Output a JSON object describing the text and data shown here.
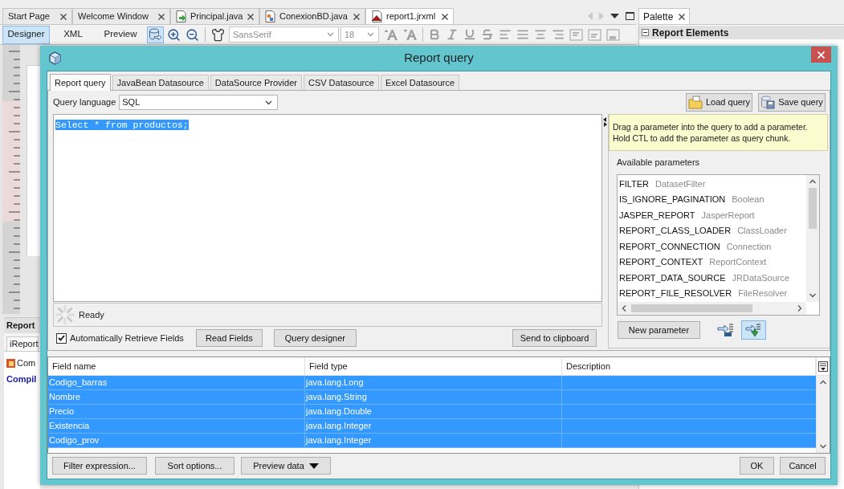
{
  "ide": {
    "editor_tabs": [
      {
        "label": "Start Page",
        "kind": "page",
        "selected": false
      },
      {
        "label": "Welcome Window",
        "kind": "page",
        "selected": false
      },
      {
        "label": "Principal.java",
        "kind": "main-class",
        "selected": false
      },
      {
        "label": "ConexionBD.java",
        "kind": "class",
        "selected": false
      },
      {
        "label": "report1.jrxml",
        "kind": "report",
        "selected": true
      }
    ],
    "view_tabs": [
      {
        "label": "Designer",
        "selected": true
      },
      {
        "label": "XML",
        "selected": false
      },
      {
        "label": "Preview",
        "selected": false
      }
    ],
    "tools": [
      {
        "kind": "query",
        "selected": true
      },
      {
        "kind": "zoom-in",
        "selected": false
      },
      {
        "kind": "zoom-out",
        "selected": false
      },
      {
        "kind": "format",
        "selected": false
      }
    ],
    "formatting": {
      "font": "SansSerif",
      "size": "18",
      "disabled": true
    },
    "palette": {
      "title": "Palette",
      "section": {
        "title": "Report Elements",
        "expanded": true
      }
    },
    "output": {
      "title": "Report",
      "tab": "iReport",
      "lines": [
        {
          "kind": "task",
          "text": "Com"
        },
        {
          "kind": "status",
          "text": "Compil"
        }
      ]
    }
  },
  "dialog": {
    "title": "Report query",
    "tabs": [
      {
        "label": "Report query",
        "selected": true
      },
      {
        "label": "JavaBean Datasource",
        "selected": false
      },
      {
        "label": "DataSource Provider",
        "selected": false
      },
      {
        "label": "CSV Datasource",
        "selected": false
      },
      {
        "label": "Excel Datasource",
        "selected": false
      }
    ],
    "query_language": {
      "label": "Query language",
      "value": "SQL"
    },
    "query_files": [
      {
        "kind": "load",
        "label": "Load query"
      },
      {
        "kind": "save",
        "label": "Save query"
      }
    ],
    "query": {
      "text": "Select * from productos;",
      "selected": true
    },
    "status": "Ready",
    "auto_retrieve": {
      "label": "Automatically Retrieve Fields",
      "checked": true
    },
    "query_buttons": [
      "Read Fields",
      "Query designer",
      "Send to clipboard"
    ],
    "hint": [
      "Drag a parameter into the query to add a parameter.",
      "Hold CTL to add the parameter as query chunk."
    ],
    "parameters": {
      "label": "Available parameters",
      "items": [
        {
          "name": "FILTER",
          "type": "DatasetFilter"
        },
        {
          "name": "IS_IGNORE_PAGINATION",
          "type": "Boolean"
        },
        {
          "name": "JASPER_REPORT",
          "type": "JasperReport"
        },
        {
          "name": "REPORT_CLASS_LOADER",
          "type": "ClassLoader"
        },
        {
          "name": "REPORT_CONNECTION",
          "type": "Connection"
        },
        {
          "name": "REPORT_CONTEXT",
          "type": "ReportContext"
        },
        {
          "name": "REPORT_DATA_SOURCE",
          "type": "JRDataSource"
        },
        {
          "name": "REPORT_FILE_RESOLVER",
          "type": "FileResolver"
        }
      ]
    },
    "new_parameter": "New parameter",
    "parameter_tools": [
      {
        "kind": "insert",
        "selected": false
      },
      {
        "kind": "chunk",
        "selected": true
      }
    ],
    "fields": {
      "columns": [
        "Field name",
        "Field type",
        "Description"
      ],
      "rows": [
        {
          "name": "Codigo_barras",
          "type": "java.lang.Long",
          "selected": true
        },
        {
          "name": "Nombre",
          "type": "java.lang.String",
          "selected": true
        },
        {
          "name": "Precio",
          "type": "java.lang.Double",
          "selected": true
        },
        {
          "name": "Existencia",
          "type": "java.lang.Integer",
          "selected": true
        },
        {
          "name": "Codigo_prov",
          "type": "java.lang.Integer",
          "selected": true
        }
      ]
    },
    "field_buttons": [
      {
        "kind": "plain",
        "label": "Filter expression..."
      },
      {
        "kind": "plain",
        "label": "Sort options..."
      },
      {
        "kind": "menu",
        "label": "Preview data"
      }
    ],
    "dialog_buttons": [
      "OK",
      "Cancel"
    ]
  }
}
